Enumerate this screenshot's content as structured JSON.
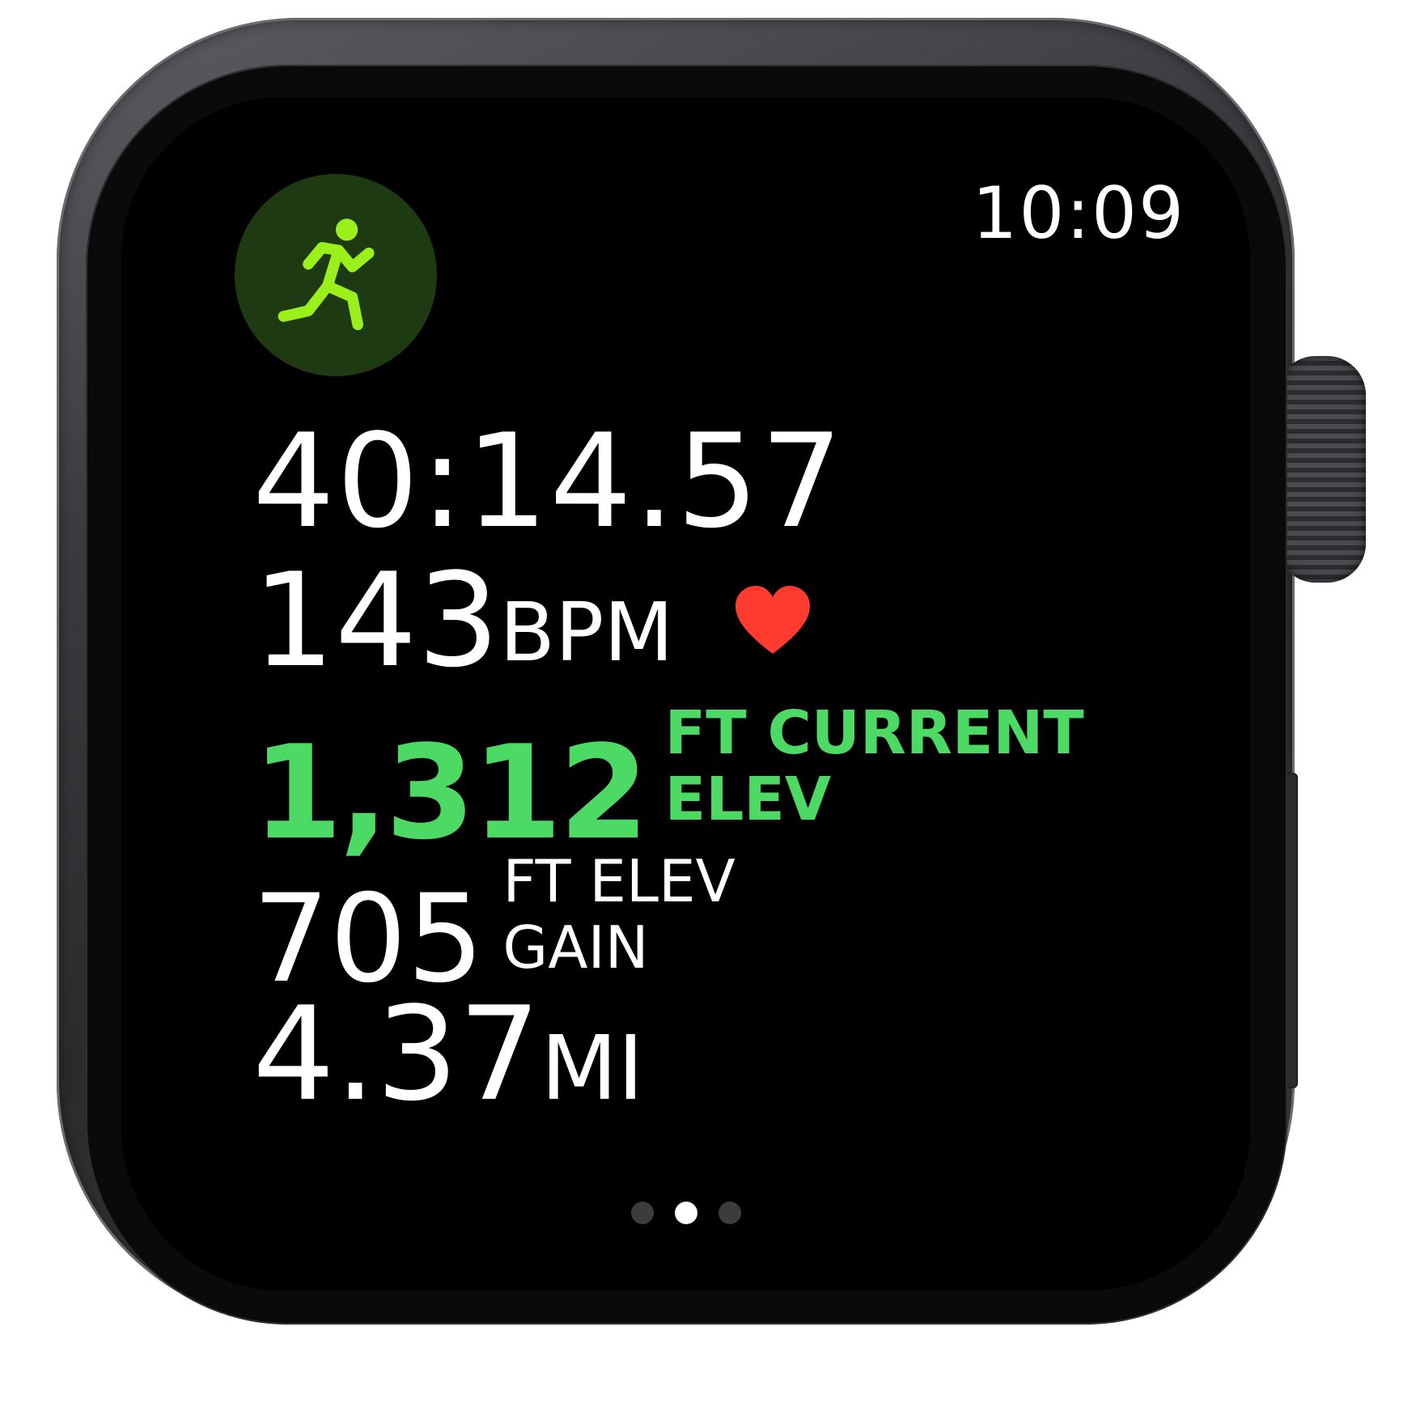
{
  "status_bar": {
    "time": "10:09"
  },
  "workout": {
    "icon": "running-figure-icon",
    "icon_color": "#9bf01c",
    "badge_color": "#1e3a12"
  },
  "metrics": {
    "elapsed_time": "40:14.57",
    "heart_rate": {
      "value": "143",
      "unit": "BPM",
      "icon": "heart-icon",
      "icon_color": "#ff3b30"
    },
    "current_elevation": {
      "value": "1,312",
      "label_line1": "FT CURRENT",
      "label_line2": "ELEV",
      "color": "#4cd964"
    },
    "elevation_gain": {
      "value": "705",
      "label_line1": "FT ELEV",
      "label_line2": "GAIN"
    },
    "distance": {
      "value": "4.37",
      "unit": "MI"
    }
  },
  "pagination": {
    "total": 3,
    "active_index": 1
  }
}
